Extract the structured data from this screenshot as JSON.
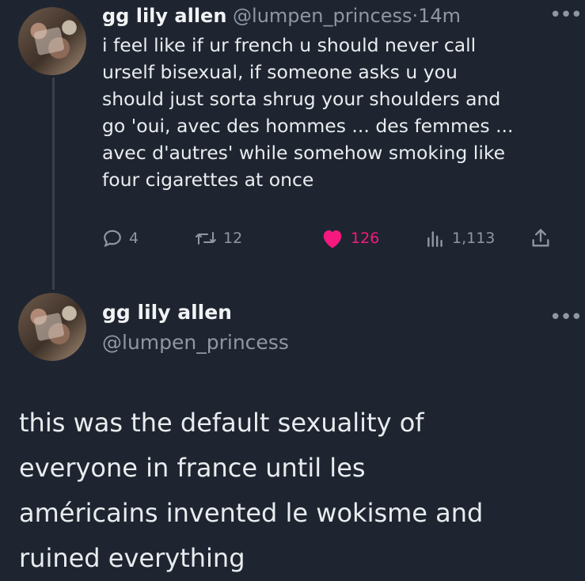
{
  "tweet1": {
    "display_name": "gg lily allen",
    "handle": "@lumpen_princess",
    "separator": "·",
    "time": "14m",
    "more_icon": "more-horizontal-icon",
    "text_lines": [
      "i feel like if ur french u should never call",
      "urself bisexual, if someone asks u you",
      "should just sorta shrug your shoulders and",
      "go 'oui, avec des hommes ... des femmes ...",
      "avec d'autres' while somehow smoking like",
      "four cigarettes at once"
    ],
    "stats": {
      "replies": "4",
      "retweets": "12",
      "likes": "126",
      "views": "1,113"
    },
    "like_color": "#f5197f"
  },
  "tweet2": {
    "display_name": "gg lily allen",
    "handle": "@lumpen_princess",
    "more_icon": "more-horizontal-icon",
    "text_lines": [
      "this was the default sexuality of",
      "everyone in france until les",
      "américains invented le wokisme and",
      "ruined everything"
    ]
  },
  "theme": {
    "background": "#1f2530",
    "text": "#e9ecef",
    "muted": "#8e97a3"
  }
}
